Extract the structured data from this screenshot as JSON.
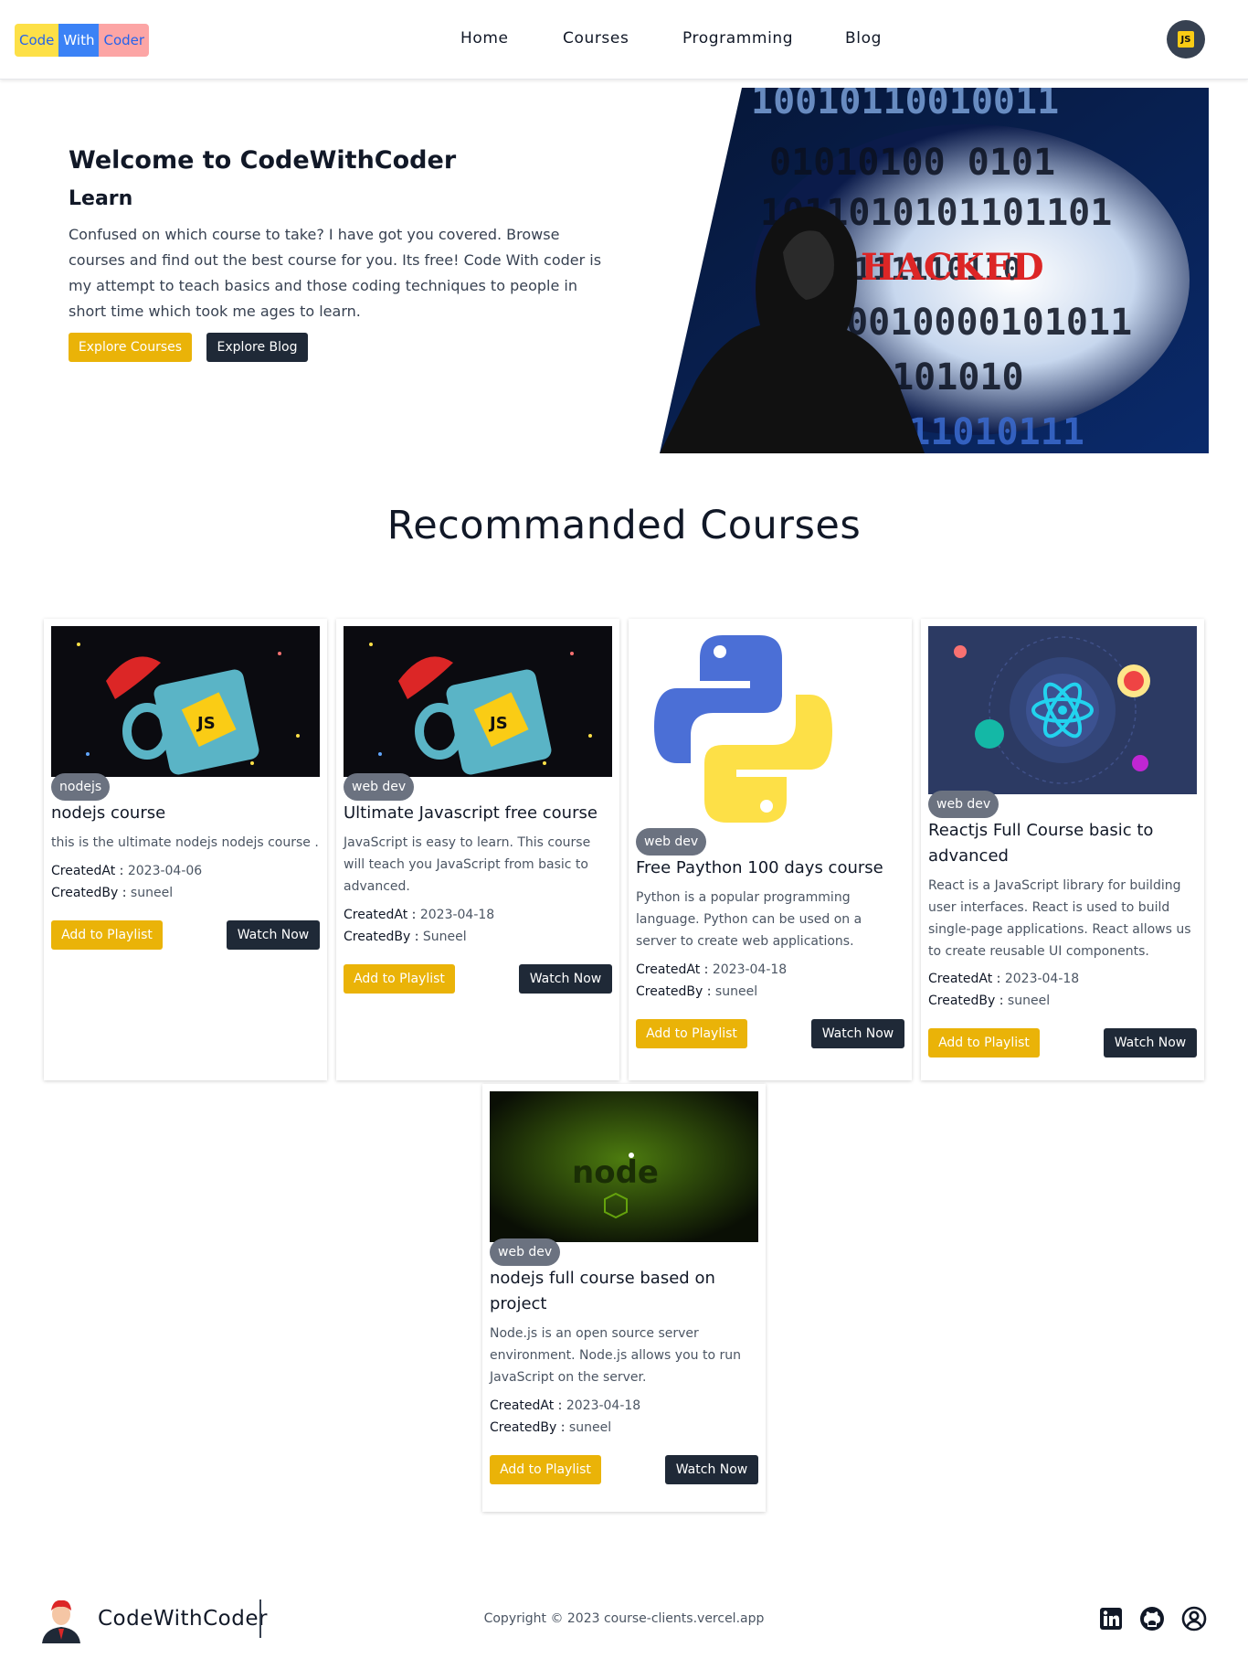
{
  "navbar": {
    "logo": [
      "Code",
      "With",
      "Coder"
    ],
    "links": [
      "Home",
      "Courses",
      "Programming",
      "Blog"
    ],
    "avatar_icon": "js-avatar-icon"
  },
  "hero": {
    "title": "Welcome to CodeWithCoder",
    "subtitle": "Learn",
    "description": "Confused on which course to take? I have got you covered. Browse courses and find out the best course for you. Its free! Code With coder is my attempt to teach basics and those coding techniques to people in short time which took me ages to learn.",
    "btn_courses": "Explore Courses",
    "btn_blog": "Explore Blog",
    "image_text": "HACKED"
  },
  "section_title": "Recommanded Courses",
  "labels": {
    "created_at": "CreatedAt : ",
    "created_by": "CreatedBy : ",
    "add": "Add to Playlist",
    "watch": "Watch Now"
  },
  "courses": [
    {
      "tag": "nodejs",
      "title": "nodejs course",
      "desc": "this is the ultimate nodejs nodejs course .",
      "created_at": "2023-04-06",
      "created_by": "suneel",
      "thumb": "js-mug"
    },
    {
      "tag": "web dev",
      "title": "Ultimate Javascript free course",
      "desc": "JavaScript is easy to learn. This course will teach you JavaScript from basic to advanced.",
      "created_at": "2023-04-18",
      "created_by": "Suneel",
      "thumb": "js-mug"
    },
    {
      "tag": "web dev",
      "title": "Free Paython 100 days course",
      "desc": "Python is a popular programming language. Python can be used on a server to create web applications.",
      "created_at": "2023-04-18",
      "created_by": "suneel",
      "thumb": "python-logo"
    },
    {
      "tag": "web dev",
      "title": "Reactjs Full Course basic to advanced",
      "desc": "React is a JavaScript library for building user interfaces. React is used to build single-page applications. React allows us to create reusable UI components.",
      "created_at": "2023-04-18",
      "created_by": "suneel",
      "thumb": "react-logo"
    },
    {
      "tag": "web dev",
      "title": "nodejs full course based on project",
      "desc": "Node.js is an open source server environment. Node.js allows you to run JavaScript on the server.",
      "created_at": "2023-04-18",
      "created_by": "suneel",
      "thumb": "node-logo"
    }
  ],
  "footer": {
    "brand": "CodeWithCoder",
    "copyright": "Copyright © 2023 course-clients.vercel.app",
    "icons": [
      "linkedin-icon",
      "github-icon",
      "account-icon"
    ]
  },
  "colors": {
    "accent_yellow": "#eab308",
    "dark": "#1f2937",
    "tag_gray": "#6b7280"
  }
}
